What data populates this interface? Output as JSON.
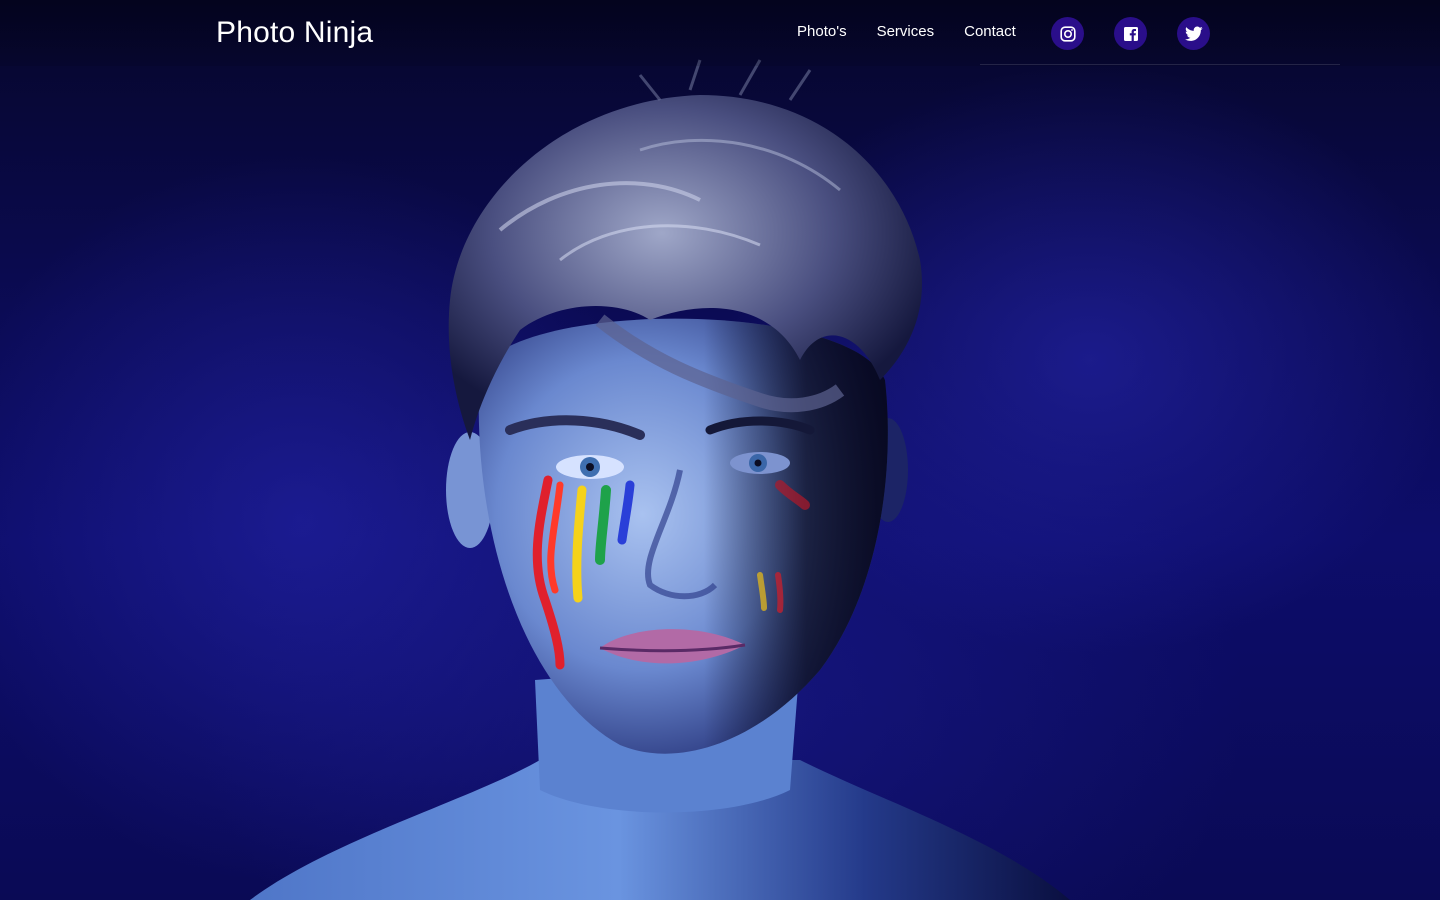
{
  "brand": {
    "name": "Photo Ninja"
  },
  "nav": {
    "links": [
      {
        "label": "Photo's"
      },
      {
        "label": "Services"
      },
      {
        "label": "Contact"
      }
    ]
  },
  "socials": [
    {
      "icon": "instagram-icon",
      "color": "#2a0e8a"
    },
    {
      "icon": "facebook-icon",
      "color": "#2a0e8a"
    },
    {
      "icon": "twitter-icon",
      "color": "#2a0e8a"
    }
  ],
  "hero": {
    "image": "portrait-photo",
    "palette": {
      "background": "#0b0b55",
      "smoke": "#2a2ab8",
      "skin": "#7c9ad6"
    }
  }
}
